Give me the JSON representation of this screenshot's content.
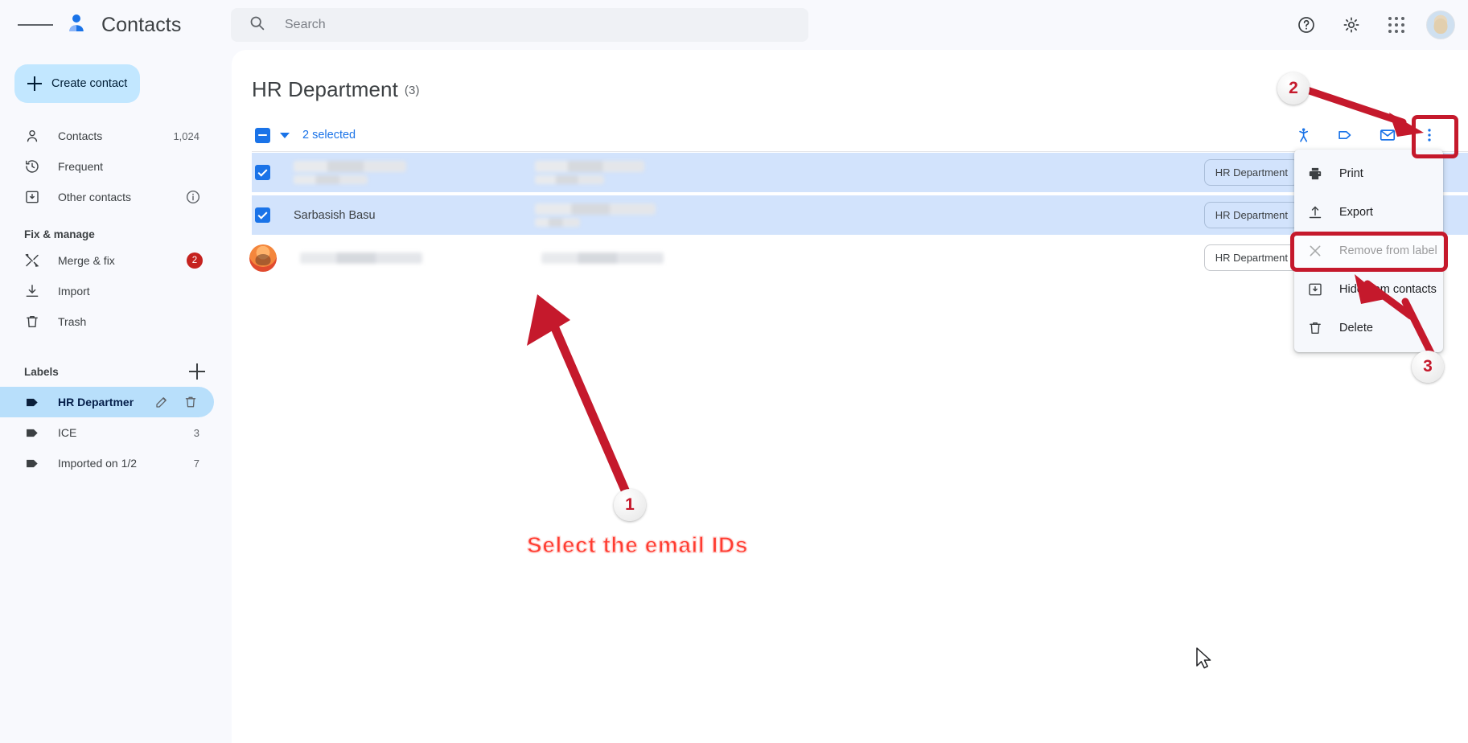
{
  "app": {
    "title": "Contacts",
    "menu_icon": "hamburger-icon",
    "logo_icon": "contacts-logo-icon"
  },
  "search": {
    "placeholder": "Search",
    "value": "",
    "icon": "search-icon"
  },
  "top_right": {
    "help_icon": "help-icon",
    "settings_icon": "gear-icon",
    "apps_icon": "apps-grid-icon",
    "avatar": "account-avatar"
  },
  "sidebar": {
    "create_label": "Create contact",
    "nav": [
      {
        "label": "Contacts",
        "count": "1,024",
        "icon": "person-icon"
      },
      {
        "label": "Frequent",
        "count": "",
        "icon": "history-icon"
      },
      {
        "label": "Other contacts",
        "count": "",
        "icon": "archive-down-icon",
        "info_icon": "info-icon"
      }
    ],
    "section_title": "Fix & manage",
    "manage": [
      {
        "label": "Merge & fix",
        "badge": "2",
        "icon": "merge-tools-icon"
      },
      {
        "label": "Import",
        "badge": "",
        "icon": "import-download-icon"
      },
      {
        "label": "Trash",
        "badge": "",
        "icon": "trash-icon"
      }
    ],
    "labels_title": "Labels",
    "add_label_icon": "plus-icon",
    "labels": [
      {
        "label": "HR Department",
        "count": "",
        "active": true,
        "icon": "label-tag-icon",
        "edit_icon": "pencil-icon",
        "delete_icon": "trash-icon"
      },
      {
        "label": "ICE",
        "count": "3",
        "active": false,
        "icon": "label-tag-icon"
      },
      {
        "label": "Imported on 1/2",
        "count": "7",
        "active": false,
        "icon": "label-tag-icon"
      }
    ]
  },
  "main": {
    "page_title": "HR Department",
    "page_count": "(3)",
    "selection_text": "2 selected",
    "select_all_state": "indeterminate",
    "toolbar_icons": [
      {
        "name": "merge-contacts-icon"
      },
      {
        "name": "manage-labels-icon"
      },
      {
        "name": "send-email-icon"
      },
      {
        "name": "more-options-icon"
      }
    ],
    "rows": [
      {
        "name": "",
        "name_redacted": true,
        "email": "",
        "email_redacted": true,
        "selected": true,
        "has_avatar": false,
        "chip": "HR Department"
      },
      {
        "name": "Sarbasish Basu",
        "name_redacted": false,
        "email": "",
        "email_redacted": true,
        "selected": true,
        "has_avatar": false,
        "chip": "HR Department"
      },
      {
        "name": "",
        "name_redacted": true,
        "email": "",
        "email_redacted": true,
        "selected": false,
        "has_avatar": true,
        "chip": "HR Department"
      }
    ]
  },
  "context_menu": {
    "items": [
      {
        "label": "Print",
        "icon": "printer-icon",
        "highlighted": false
      },
      {
        "label": "Export",
        "icon": "export-upload-icon",
        "highlighted": false
      },
      {
        "label": "Remove from label",
        "icon": "close-x-icon",
        "highlighted": true
      },
      {
        "label": "Hide from contacts",
        "icon": "archive-down-icon",
        "highlighted": false
      },
      {
        "label": "Delete",
        "icon": "trash-icon",
        "highlighted": false
      }
    ]
  },
  "annotations": {
    "step1": "1",
    "step2": "2",
    "step3": "3",
    "instruction": "Select the email IDs",
    "accent_color": "#c5192c",
    "instruction_color": "#ff3b30"
  },
  "colors": {
    "brand_blue": "#1a73e8",
    "selected_row": "#d2e3fc",
    "active_label": "#b8dffb",
    "create_button": "#c2e7ff",
    "badge_red": "#c5221f",
    "page_bg": "#f8f9fd",
    "panel_bg": "#ffffff"
  }
}
